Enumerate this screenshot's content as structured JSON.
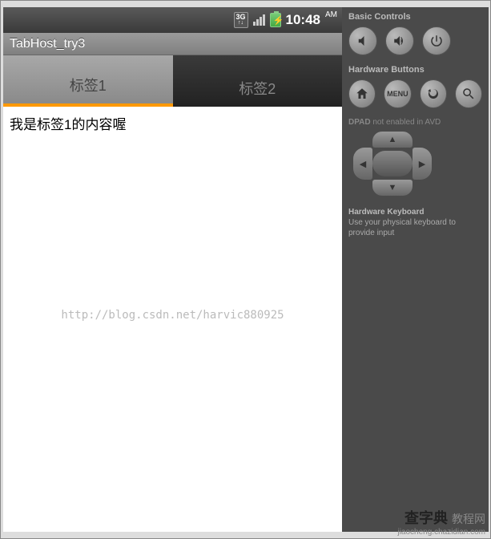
{
  "status_bar": {
    "network_label": "3G",
    "time": "10:48",
    "ampm": "AM"
  },
  "app": {
    "title": "TabHost_try3"
  },
  "tabs": [
    {
      "label": "标签1",
      "active": true
    },
    {
      "label": "标签2",
      "active": false
    }
  ],
  "content": {
    "text": "我是标签1的内容喔"
  },
  "watermark": "http://blog.csdn.net/harvic880925",
  "side_panel": {
    "basic_controls_title": "Basic Controls",
    "hardware_buttons_title": "Hardware Buttons",
    "menu_label": "MENU",
    "dpad_title": "DPAD",
    "dpad_note": "not enabled in AVD",
    "keyboard_title": "Hardware Keyboard",
    "keyboard_note": "Use your physical keyboard to provide input"
  },
  "footer": {
    "brand": "查字典",
    "suffix": "教程网",
    "url": "jiaocheng.chazidian.com"
  }
}
